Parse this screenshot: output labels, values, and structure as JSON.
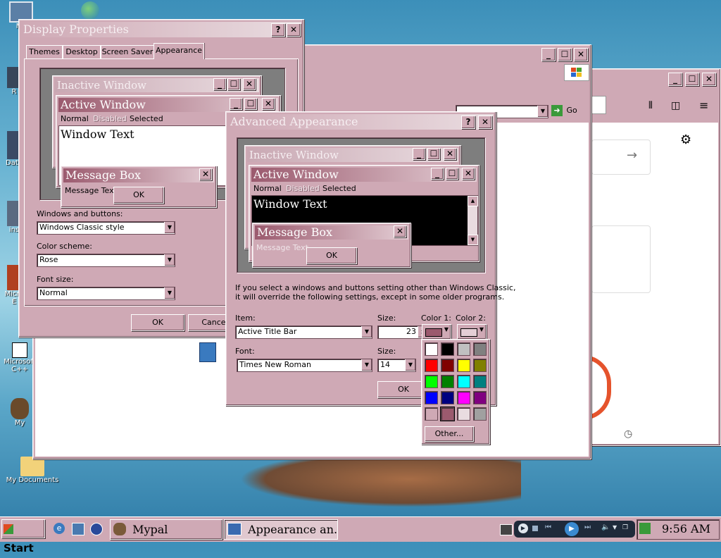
{
  "desktop": {
    "icons": [
      {
        "label": "My"
      },
      {
        "label": "R"
      },
      {
        "label": "Data"
      },
      {
        "label": "ins"
      },
      {
        "label": "Micro"
      },
      {
        "label": "E"
      },
      {
        "label": "Microsoft C++"
      },
      {
        "label": "My"
      },
      {
        "label": "My Documents"
      }
    ]
  },
  "display_props": {
    "title": "Display Properties",
    "help": "?",
    "close": "✕",
    "tabs": [
      "Themes",
      "Desktop",
      "Screen Saver",
      "Appearance"
    ],
    "preview": {
      "inactive_title": "Inactive Window",
      "active_title": "Active Window",
      "menu_normal": "Normal",
      "menu_disabled": "Disabled",
      "menu_selected": "Selected",
      "window_text": "Window Text",
      "msgbox_title": "Message Box",
      "msgbox_text": "Message Text",
      "msgbox_ok": "OK"
    },
    "windows_buttons_label": "Windows and buttons:",
    "windows_buttons_value": "Windows Classic style",
    "color_scheme_label": "Color scheme:",
    "color_scheme_value": "Rose",
    "font_size_label": "Font size:",
    "font_size_value": "Normal",
    "ok": "OK",
    "cancel": "Cancel"
  },
  "browser_back": {
    "go_label": "Go"
  },
  "advanced": {
    "title": "Advanced Appearance",
    "help": "?",
    "close": "✕",
    "preview": {
      "inactive_title": "Inactive Window",
      "active_title": "Active Window",
      "menu_normal": "Normal",
      "menu_disabled": "Disabled",
      "menu_selected": "Selected",
      "window_text": "Window Text",
      "msgbox_title": "Message Box",
      "msgbox_text": "Message Text",
      "msgbox_ok": "OK"
    },
    "info_line1": "If you select a windows and buttons setting other than Windows Classic,",
    "info_line2": "it will override the following settings, except in some older programs.",
    "item_label": "Item:",
    "item_value": "Active Title Bar",
    "size_label": "Size:",
    "size_value": "23",
    "color1_label": "Color 1:",
    "color2_label": "Color 2:",
    "font_label": "Font:",
    "font_value": "Times New Roman",
    "font_size_label": "Size:",
    "font_size_value": "14",
    "ok": "OK",
    "color1_hex": "#9b5a6e",
    "color2_hex": "#e4ced5"
  },
  "palette": {
    "colors": [
      "#ffffff",
      "#000000",
      "#c0c0c0",
      "#808080",
      "#ff0000",
      "#800000",
      "#ffff00",
      "#808000",
      "#00ff00",
      "#008000",
      "#00ffff",
      "#008080",
      "#0000ff",
      "#000080",
      "#ff00ff",
      "#800080",
      "#cfa9b5",
      "#9b5a6e",
      "#e9dce0",
      "#a0a0a0"
    ],
    "other_label": "Other..."
  },
  "taskbar": {
    "start_label": "Start",
    "tasks": [
      "Mypal",
      "Appearance an..."
    ],
    "clock": "9:56 AM"
  }
}
